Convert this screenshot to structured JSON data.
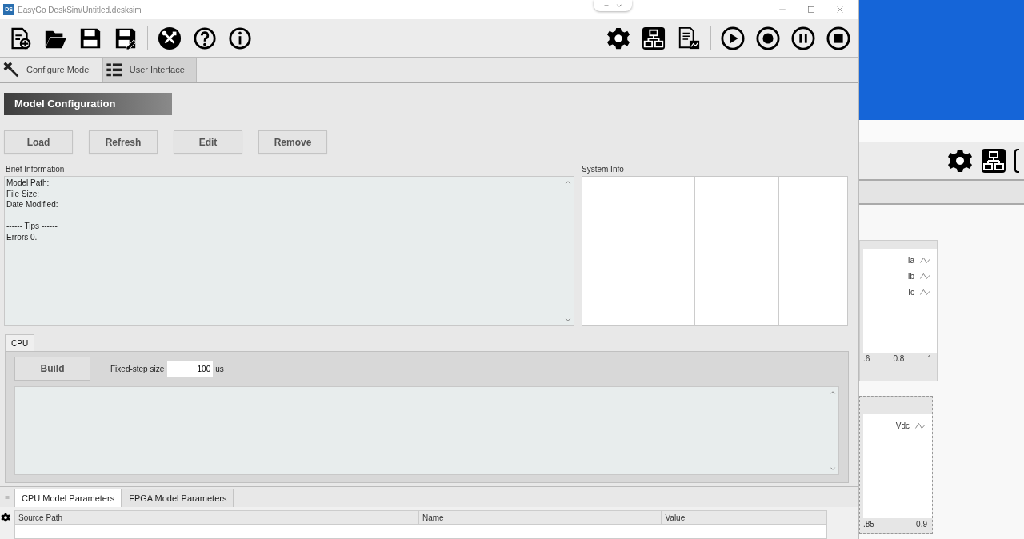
{
  "window": {
    "title": "EasyGo DeskSim/Untitled.desksim",
    "app_badge": "DS"
  },
  "main_tabs": [
    {
      "label": "Configure Model",
      "selected": true
    },
    {
      "label": "User Interface",
      "selected": false
    }
  ],
  "section_title": "Model Configuration",
  "buttons": [
    "Load",
    "Refresh",
    "Edit",
    "Remove"
  ],
  "brief_information": {
    "label": "Brief Information",
    "fields": [
      "Model Path:",
      "File Size:",
      "Date Modified:"
    ],
    "tips": [
      "------ Tips ------",
      "Errors 0."
    ]
  },
  "system_info": {
    "label": "System Info"
  },
  "cpu_tabs": [
    {
      "label": "CPU",
      "selected": true
    }
  ],
  "build": {
    "button": "Build",
    "step_label": "Fixed-step size",
    "step_value": "100",
    "step_unit": "us"
  },
  "parameter_tabs": [
    {
      "label": "CPU Model Parameters",
      "selected": true
    },
    {
      "label": "FPGA Model Parameters",
      "selected": false
    }
  ],
  "parameter_table": {
    "columns": [
      "Source Path",
      "Name",
      "Value"
    ]
  },
  "background_window": {
    "plot_1": {
      "legend": [
        "Ia",
        "Ib",
        "Ic"
      ],
      "tick_labels": [
        ".6",
        "0.8",
        "1"
      ]
    },
    "plot_2": {
      "legend": [
        "Vdc"
      ],
      "tick_labels": [
        ".85",
        "0.9"
      ]
    }
  }
}
